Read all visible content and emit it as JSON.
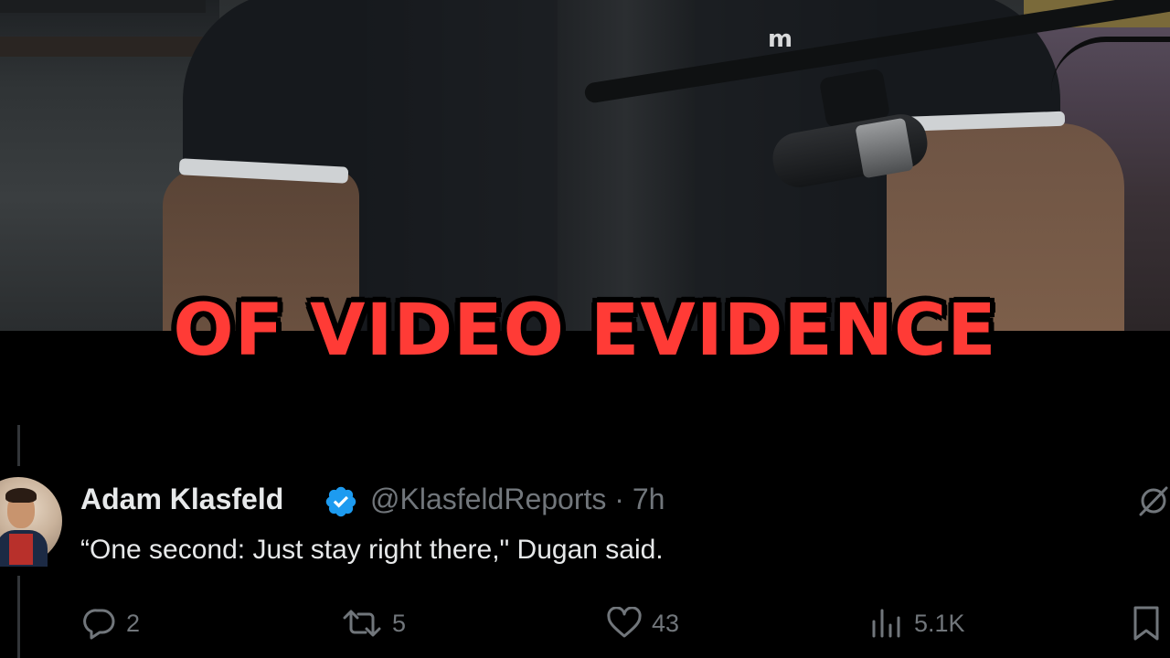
{
  "caption": "OF VIDEO EVIDENCE",
  "video": {
    "shirt_logo": "m"
  },
  "tweet": {
    "author_name": "Adam Klasfeld",
    "handle_time": "@KlasfeldReports · 7h",
    "text": "“One second: Just stay right there,\" Dugan said.",
    "verified_icon": "verified-badge-icon",
    "actions": {
      "replies": "2",
      "reposts": "5",
      "likes": "43",
      "views": "5.1K"
    }
  },
  "colors": {
    "caption": "#ff3b36",
    "verified": "#1d9bf0",
    "text_primary": "#e7e9ea",
    "text_secondary": "#71767b",
    "background": "#000000"
  }
}
